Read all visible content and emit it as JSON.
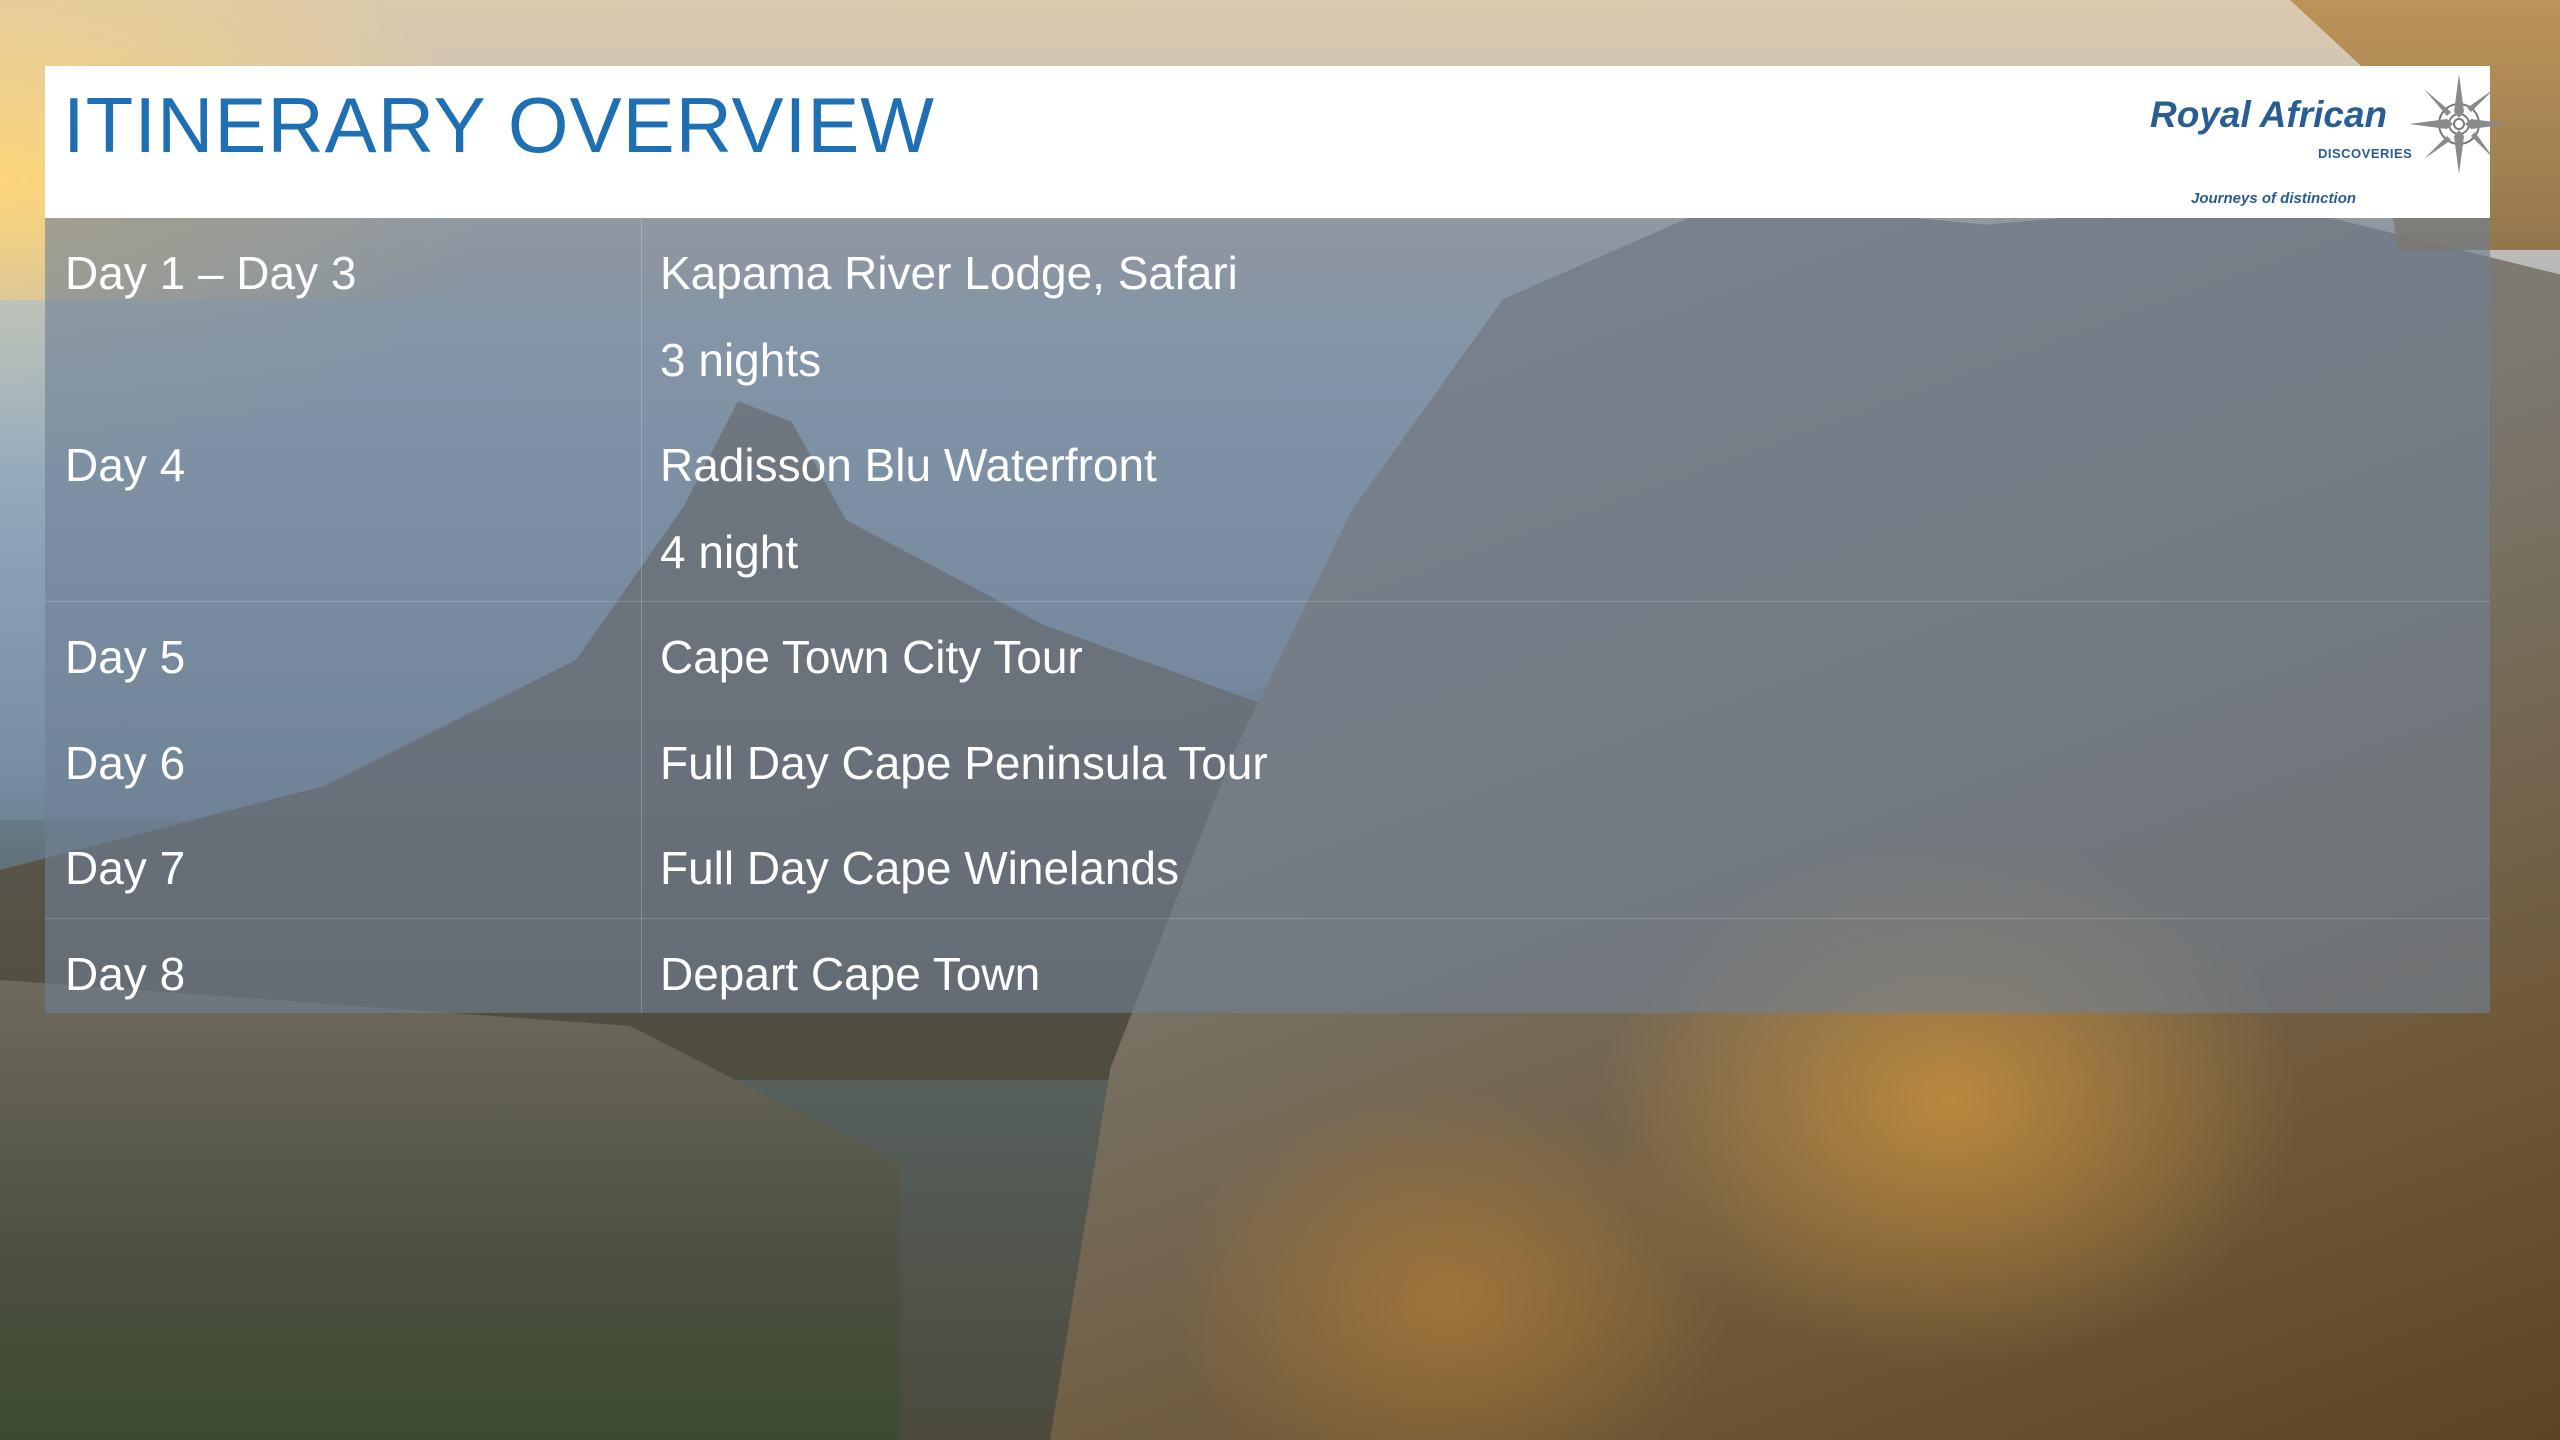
{
  "header": {
    "title": "ITINERARY OVERVIEW",
    "logo": {
      "name": "Royal African",
      "subtitle": "DISCOVERIES",
      "tagline": "Journeys of distinction",
      "icon": "compass-rose-icon"
    }
  },
  "itinerary": [
    {
      "day": "Day 1 – Day 3",
      "description": "Kapama River Lodge, Safari",
      "detail": "3 nights"
    },
    {
      "day": "Day 4",
      "description": "Radisson Blu Waterfront",
      "detail": "4 night"
    },
    {
      "day": "Day 5",
      "description": "Cape Town City Tour"
    },
    {
      "day": "Day 6",
      "description": "Full Day Cape Peninsula Tour"
    },
    {
      "day": "Day 7",
      "description": "Full Day Cape Winelands"
    },
    {
      "day": "Day 8",
      "description": "Depart Cape Town"
    }
  ],
  "colors": {
    "title": "#1f6fb3",
    "logo": "#2a5d91",
    "table_background": "#708094",
    "table_text": "#ffffff"
  }
}
